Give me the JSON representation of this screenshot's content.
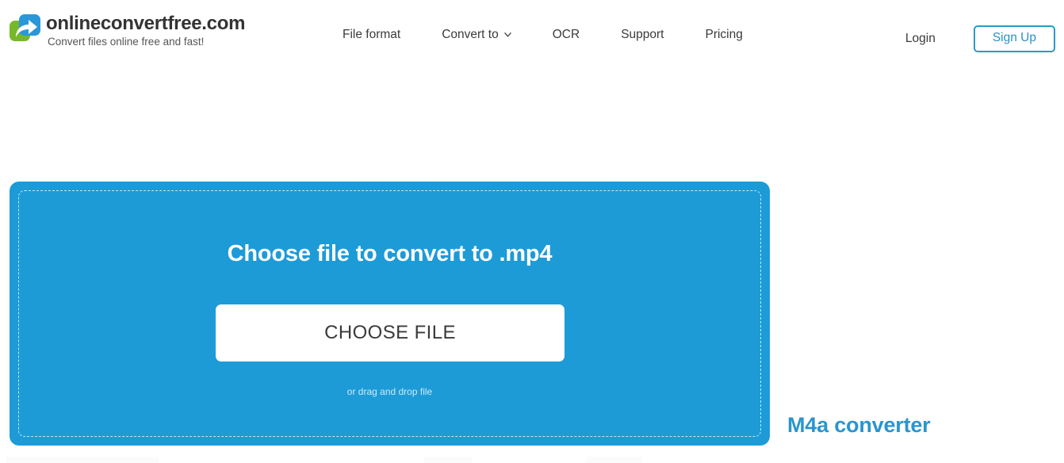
{
  "site": {
    "brand_name": "onlineconvertfree.com",
    "tagline": "Convert files online free and fast!",
    "logo_icon": "convert-arrow-logo-icon",
    "accent_blue": "#1d9bd7",
    "brand_blue": "#2a98d8",
    "brand_green": "#76b82a",
    "heading_blue": "#2a95cf"
  },
  "nav": {
    "items": [
      {
        "label": "File format",
        "has_dropdown": false
      },
      {
        "label": "Convert to",
        "has_dropdown": true,
        "icon": "chevron-down-icon"
      },
      {
        "label": "OCR",
        "has_dropdown": false
      },
      {
        "label": "Support",
        "has_dropdown": false
      },
      {
        "label": "Pricing",
        "has_dropdown": false
      }
    ],
    "login_label": "Login",
    "signup_label": "Sign Up"
  },
  "dropzone": {
    "title": "Choose file to convert to .mp4",
    "button_label": "CHOOSE FILE",
    "hint": "or drag and drop file",
    "background_color": "#1d9bd7",
    "border_style": "dashed"
  },
  "side": {
    "heading": "M4a converter"
  }
}
